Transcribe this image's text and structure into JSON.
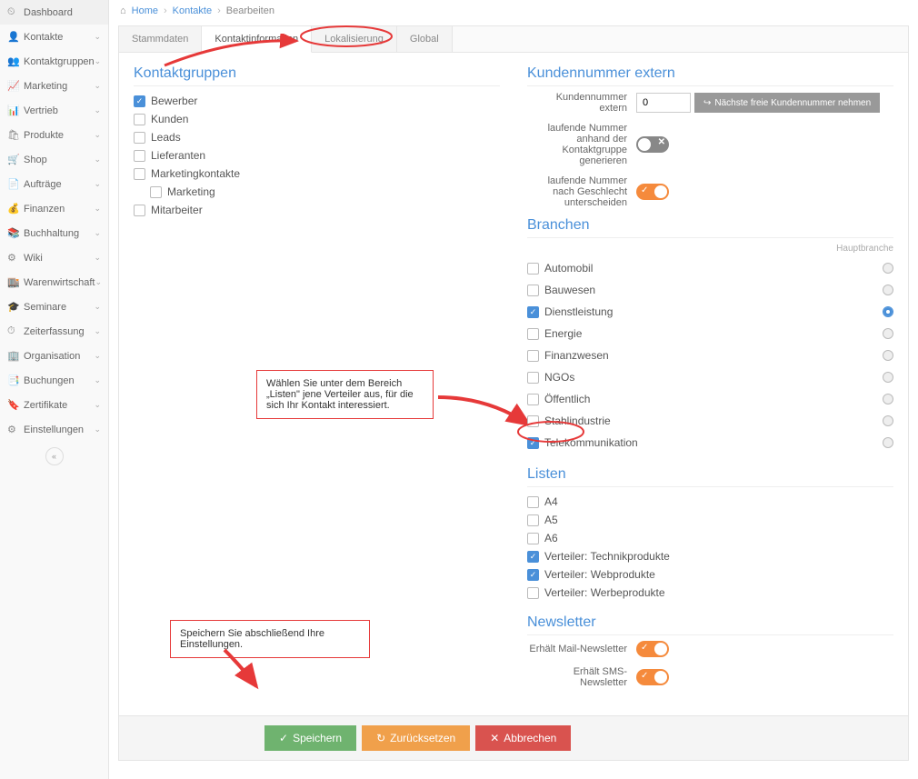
{
  "breadcrumb": {
    "home": "Home",
    "kontakte": "Kontakte",
    "bearbeiten": "Bearbeiten"
  },
  "sidebar": {
    "items": [
      {
        "icon": "⏲",
        "label": "Dashboard",
        "expandable": false
      },
      {
        "icon": "👤",
        "label": "Kontakte",
        "expandable": true
      },
      {
        "icon": "👥",
        "label": "Kontaktgruppen",
        "expandable": true
      },
      {
        "icon": "📈",
        "label": "Marketing",
        "expandable": true
      },
      {
        "icon": "📊",
        "label": "Vertrieb",
        "expandable": true
      },
      {
        "icon": "🛍",
        "label": "Produkte",
        "expandable": true
      },
      {
        "icon": "🛒",
        "label": "Shop",
        "expandable": true
      },
      {
        "icon": "📄",
        "label": "Aufträge",
        "expandable": true
      },
      {
        "icon": "💰",
        "label": "Finanzen",
        "expandable": true
      },
      {
        "icon": "📚",
        "label": "Buchhaltung",
        "expandable": true
      },
      {
        "icon": "⚙",
        "label": "Wiki",
        "expandable": true
      },
      {
        "icon": "🏬",
        "label": "Warenwirtschaft",
        "expandable": true
      },
      {
        "icon": "🎓",
        "label": "Seminare",
        "expandable": true
      },
      {
        "icon": "⏱",
        "label": "Zeiterfassung",
        "expandable": true
      },
      {
        "icon": "🏢",
        "label": "Organisation",
        "expandable": true
      },
      {
        "icon": "📑",
        "label": "Buchungen",
        "expandable": true
      },
      {
        "icon": "🔖",
        "label": "Zertifikate",
        "expandable": true
      },
      {
        "icon": "⚙",
        "label": "Einstellungen",
        "expandable": true
      }
    ]
  },
  "tabs": [
    {
      "label": "Stammdaten",
      "active": false
    },
    {
      "label": "Kontaktinformation",
      "active": true
    },
    {
      "label": "Lokalisierung",
      "active": false
    },
    {
      "label": "Global",
      "active": false
    }
  ],
  "kontaktgruppen": {
    "title": "Kontaktgruppen",
    "items": [
      {
        "label": "Bewerber",
        "checked": true
      },
      {
        "label": "Kunden",
        "checked": false
      },
      {
        "label": "Leads",
        "checked": false
      },
      {
        "label": "Lieferanten",
        "checked": false
      },
      {
        "label": "Marketingkontakte",
        "checked": false
      },
      {
        "label": "Marketing",
        "checked": false,
        "indent": true
      },
      {
        "label": "Mitarbeiter",
        "checked": false
      }
    ]
  },
  "kundennummer": {
    "title": "Kundennummer extern",
    "field_label": "Kundennummer extern",
    "value": "0",
    "button": "Nächste freie Kundennummer nehmen",
    "opt1_label": "laufende Nummer anhand der Kontaktgruppe generieren",
    "opt1_on": false,
    "opt2_label": "laufende Nummer nach Geschlecht unterscheiden",
    "opt2_on": true
  },
  "branchen": {
    "title": "Branchen",
    "haupt_label": "Hauptbranche",
    "items": [
      {
        "label": "Automobil",
        "checked": false,
        "haupt": false
      },
      {
        "label": "Bauwesen",
        "checked": false,
        "haupt": false
      },
      {
        "label": "Dienstleistung",
        "checked": true,
        "haupt": true
      },
      {
        "label": "Energie",
        "checked": false,
        "haupt": false
      },
      {
        "label": "Finanzwesen",
        "checked": false,
        "haupt": false
      },
      {
        "label": "NGOs",
        "checked": false,
        "haupt": false
      },
      {
        "label": "Öffentlich",
        "checked": false,
        "haupt": false
      },
      {
        "label": "Stahlindustrie",
        "checked": false,
        "haupt": false
      },
      {
        "label": "Telekommunikation",
        "checked": true,
        "haupt": false
      }
    ]
  },
  "listen": {
    "title": "Listen",
    "items": [
      {
        "label": "A4",
        "checked": false
      },
      {
        "label": "A5",
        "checked": false
      },
      {
        "label": "A6",
        "checked": false
      },
      {
        "label": "Verteiler: Technikprodukte",
        "checked": true
      },
      {
        "label": "Verteiler: Webprodukte",
        "checked": true
      },
      {
        "label": "Verteiler: Werbeprodukte",
        "checked": false
      }
    ]
  },
  "newsletter": {
    "title": "Newsletter",
    "mail_label": "Erhält Mail-Newsletter",
    "mail_on": true,
    "sms_label": "Erhält SMS-Newsletter",
    "sms_on": true
  },
  "annotations": {
    "listen_hint": "Wählen Sie unter dem Bereich „Listen\" jene Verteiler aus, für die sich Ihr Kontakt interessiert.",
    "save_hint": "Speichern Sie abschließend Ihre Einstellungen."
  },
  "footer": {
    "save": "Speichern",
    "reset": "Zurücksetzen",
    "cancel": "Abbrechen"
  }
}
